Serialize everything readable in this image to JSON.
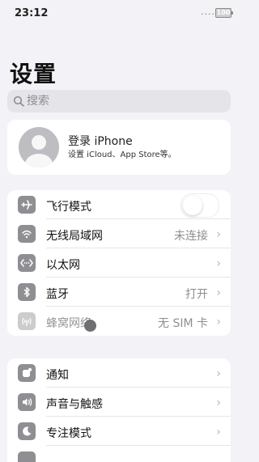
{
  "status_bar": {
    "time": "23:12",
    "dots": "....",
    "battery": "100"
  },
  "title": "设置",
  "search": {
    "placeholder": "搜索"
  },
  "account": {
    "title": "登录 iPhone",
    "subtitle": "设置 iCloud、App Store等。"
  },
  "group1": [
    {
      "label": "飞行模式",
      "icon": "airplane-icon",
      "control": "toggle",
      "on": false
    },
    {
      "label": "无线局域网",
      "icon": "wifi-icon",
      "value": "未连接",
      "chevron": "›"
    },
    {
      "label": "以太网",
      "icon": "ethernet-icon",
      "value": "",
      "chevron": "›"
    },
    {
      "label": "蓝牙",
      "icon": "bluetooth-icon",
      "value": "打开",
      "chevron": "›"
    },
    {
      "label": "蜂窝网络",
      "icon": "cellular-icon",
      "value": "无 SIM 卡",
      "chevron": "›",
      "dimmed": true
    }
  ],
  "group2": [
    {
      "label": "通知",
      "icon": "notification-icon",
      "chevron": "›"
    },
    {
      "label": "声音与触感",
      "icon": "speaker-icon",
      "chevron": "›"
    },
    {
      "label": "专注模式",
      "icon": "moon-icon",
      "chevron": "›"
    }
  ],
  "colors": {
    "background": "#f2f2f7",
    "icon_tile": "#8e8e93",
    "secondary_text": "#8e8e93"
  }
}
